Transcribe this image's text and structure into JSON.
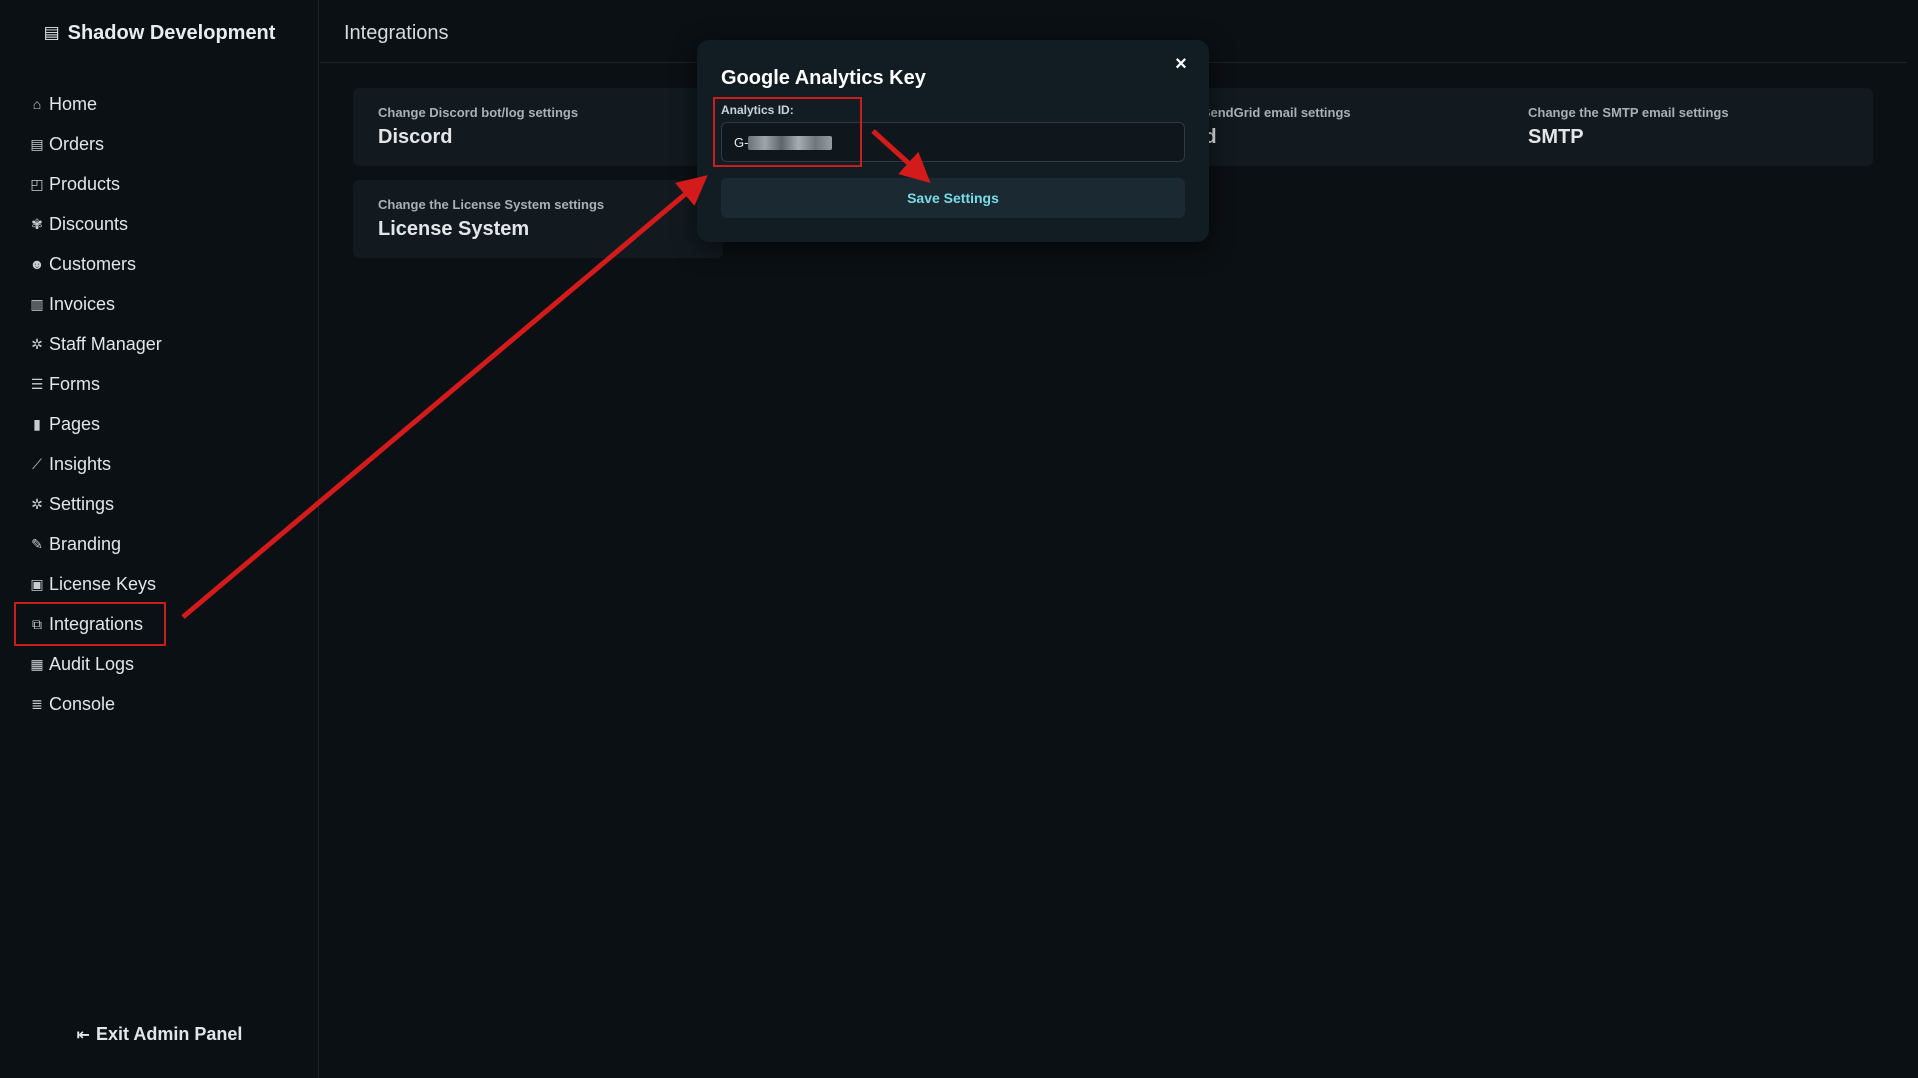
{
  "brand": {
    "name": "Shadow Development",
    "icon": "store-icon"
  },
  "sidebar": {
    "items": [
      {
        "label": "Home",
        "icon": "home-icon",
        "glyph": "⌂"
      },
      {
        "label": "Orders",
        "icon": "receipt-icon",
        "glyph": "▤"
      },
      {
        "label": "Products",
        "icon": "box-icon",
        "glyph": "◰"
      },
      {
        "label": "Discounts",
        "icon": "badge-icon",
        "glyph": "✾"
      },
      {
        "label": "Customers",
        "icon": "users-icon",
        "glyph": "☻"
      },
      {
        "label": "Invoices",
        "icon": "file-invoice-icon",
        "glyph": "▥"
      },
      {
        "label": "Staff Manager",
        "icon": "gear-icon",
        "glyph": "✲"
      },
      {
        "label": "Forms",
        "icon": "form-icon",
        "glyph": "☰"
      },
      {
        "label": "Pages",
        "icon": "page-icon",
        "glyph": "▮"
      },
      {
        "label": "Insights",
        "icon": "chart-line-icon",
        "glyph": "⟋"
      },
      {
        "label": "Settings",
        "icon": "gear-icon",
        "glyph": "✲"
      },
      {
        "label": "Branding",
        "icon": "pen-icon",
        "glyph": "✎"
      },
      {
        "label": "License Keys",
        "icon": "id-card-icon",
        "glyph": "▣"
      },
      {
        "label": "Integrations",
        "icon": "external-link-icon",
        "glyph": "⧉"
      },
      {
        "label": "Audit Logs",
        "icon": "clipboard-icon",
        "glyph": "▦"
      },
      {
        "label": "Console",
        "icon": "server-icon",
        "glyph": "≣"
      }
    ],
    "active": "Integrations",
    "exit_label": "Exit Admin Panel",
    "exit_icon": "sign-out-icon"
  },
  "header": {
    "title": "Integrations"
  },
  "cards": [
    {
      "subtitle": "Change Discord bot/log settings",
      "title": "Discord"
    },
    {
      "subtitle": "e SendGrid email settings",
      "title": "rid"
    },
    {
      "subtitle": "Change the SMTP email settings",
      "title": "SMTP"
    },
    {
      "subtitle": "Change the License System settings",
      "title": "License System"
    }
  ],
  "modal": {
    "title": "Google Analytics Key",
    "field_label": "Analytics ID:",
    "field_value": "G-",
    "save_label": "Save Settings",
    "close_glyph": "×"
  },
  "colors": {
    "annotation": "#c81e1e",
    "accent": "#79dbe6",
    "background": "#0b1014"
  }
}
